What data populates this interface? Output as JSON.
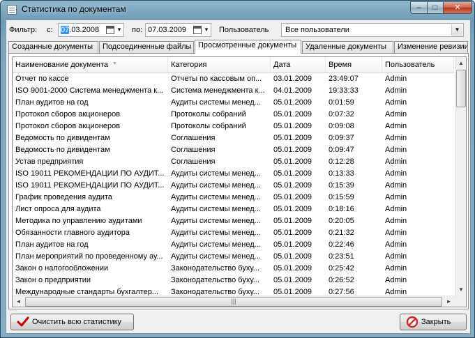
{
  "window": {
    "title": "Статистика по документам"
  },
  "title_buttons": {
    "minimize": "–",
    "maximize": "□",
    "close": "✕"
  },
  "filter": {
    "label": "Фильтр:",
    "from_label": "с:",
    "from_value_selected": "07",
    "from_value_rest": ".03.2008",
    "to_label": "по:",
    "to_value": "07.03.2009",
    "user_label": "Пользователь",
    "user_value": "Все пользователи"
  },
  "tabs": [
    {
      "label": "Созданные документы"
    },
    {
      "label": "Подсоединенные файлы"
    },
    {
      "label": "Просмотренные документы"
    },
    {
      "label": "Удаленные документы"
    },
    {
      "label": "Изменение ревизии"
    }
  ],
  "active_tab": 2,
  "columns": [
    "Наименование документа",
    "Категория",
    "Дата",
    "Время",
    "Пользователь"
  ],
  "rows": [
    [
      "Отчет по кассе",
      "Отчеты по кассовым оп...",
      "03.01.2009",
      "23:49:07",
      "Admin"
    ],
    [
      "ISO 9001-2000 Система менеджмента к...",
      "Система менеджмента к...",
      "04.01.2009",
      "19:33:33",
      "Admin"
    ],
    [
      "План аудитов на год",
      "Аудиты системы менед...",
      "05.01.2009",
      "0:01:59",
      "Admin"
    ],
    [
      "Протокол сборов акционеров",
      "Протоколы собраний",
      "05.01.2009",
      "0:07:32",
      "Admin"
    ],
    [
      "Протокол сборов акционеров",
      "Протоколы собраний",
      "05.01.2009",
      "0:09:08",
      "Admin"
    ],
    [
      "Ведомость по дивидентам",
      "Соглашения",
      "05.01.2009",
      "0:09:37",
      "Admin"
    ],
    [
      "Ведомость по дивидентам",
      "Соглашения",
      "05.01.2009",
      "0:09:47",
      "Admin"
    ],
    [
      "Устав предприятия",
      "Соглашения",
      "05.01.2009",
      "0:12:28",
      "Admin"
    ],
    [
      "ISO 19011 РЕКОМЕНДАЦИИ ПО АУДИТ...",
      "Аудиты системы менед...",
      "05.01.2009",
      "0:13:33",
      "Admin"
    ],
    [
      "ISO 19011 РЕКОМЕНДАЦИИ ПО АУДИТ...",
      "Аудиты системы менед...",
      "05.01.2009",
      "0:15:39",
      "Admin"
    ],
    [
      "График проведения аудита",
      "Аудиты системы менед...",
      "05.01.2009",
      "0:15:59",
      "Admin"
    ],
    [
      "Лист опроса для аудита",
      "Аудиты системы менед...",
      "05.01.2009",
      "0:18:16",
      "Admin"
    ],
    [
      "Методика по управлению аудитами",
      "Аудиты системы менед...",
      "05.01.2009",
      "0:20:05",
      "Admin"
    ],
    [
      "Обязанности главного аудитора",
      "Аудиты системы менед...",
      "05.01.2009",
      "0:21:32",
      "Admin"
    ],
    [
      "План аудитов на год",
      "Аудиты системы менед...",
      "05.01.2009",
      "0:22:46",
      "Admin"
    ],
    [
      "План мероприятий по проведенному ау...",
      "Аудиты системы менед...",
      "05.01.2009",
      "0:23:51",
      "Admin"
    ],
    [
      "Закон о налогообложении",
      "Законодательство буху...",
      "05.01.2009",
      "0:25:42",
      "Admin"
    ],
    [
      "Закон о предприятии",
      "Законодательство буху...",
      "05.01.2009",
      "0:26:52",
      "Admin"
    ],
    [
      "Международные стандарты бухгалтер...",
      "Законодательство буху...",
      "05.01.2009",
      "0:27:56",
      "Admin"
    ]
  ],
  "buttons": {
    "clear_stats": "Очистить всю статистику",
    "close": "Закрыть"
  },
  "scroll_glyphs": {
    "up": "▲",
    "down": "▼",
    "left": "◄",
    "right": "►",
    "grip": "|||"
  },
  "colors": {
    "selection": "#3399ff",
    "check": "#cc0000",
    "close_icon": "#d4261b"
  }
}
